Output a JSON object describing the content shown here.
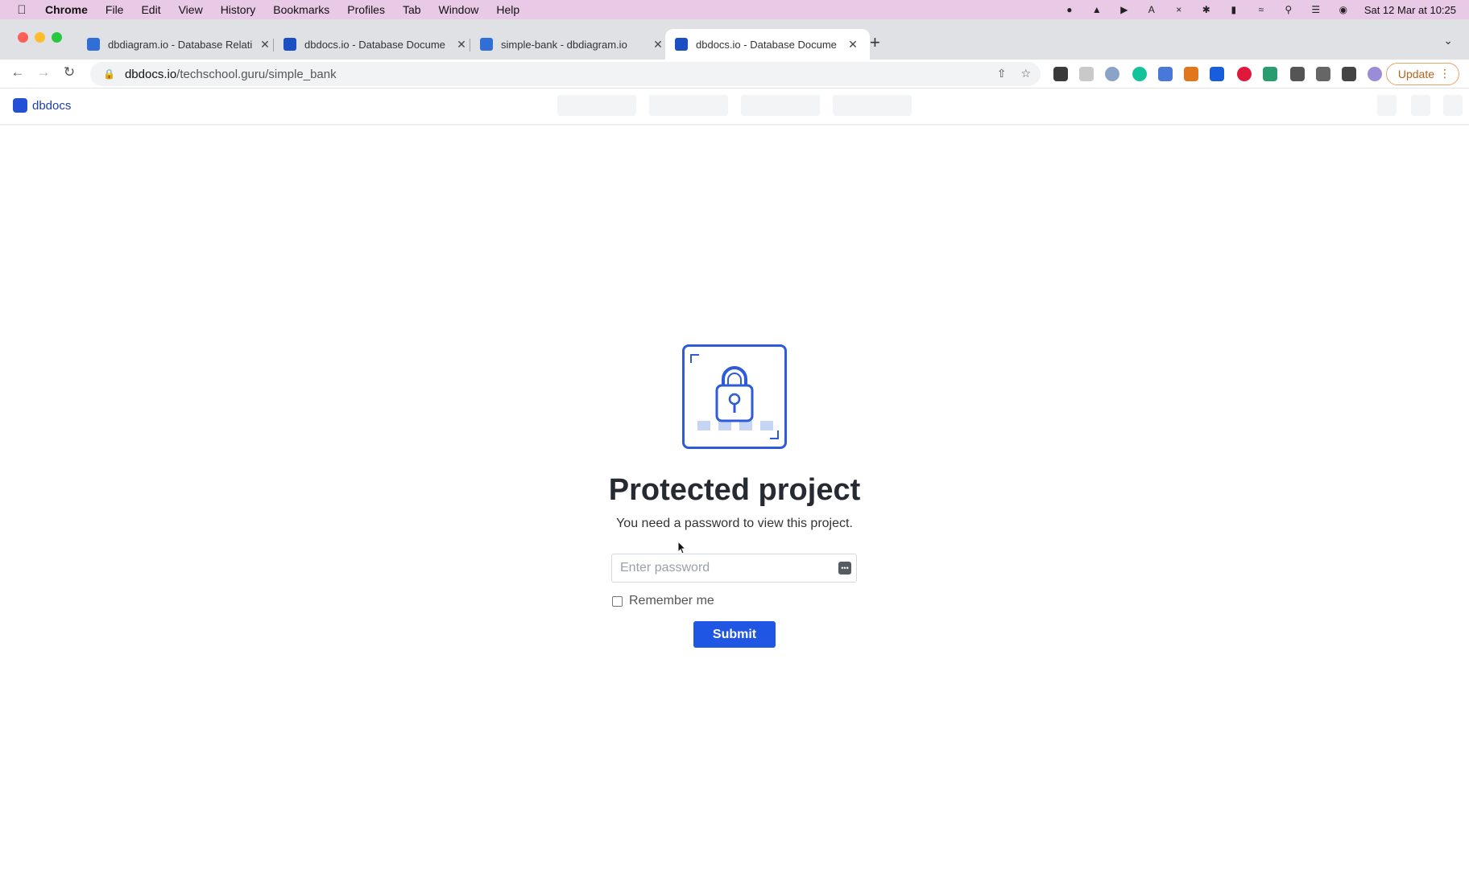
{
  "menubar": {
    "app": "Chrome",
    "items": [
      "File",
      "Edit",
      "View",
      "History",
      "Bookmarks",
      "Profiles",
      "Tab",
      "Window",
      "Help"
    ],
    "clock": "Sat 12 Mar at 10:25"
  },
  "tabs": [
    {
      "title": "dbdiagram.io - Database Relati",
      "favicon": "dbdiagram-icon"
    },
    {
      "title": "dbdocs.io - Database Docume",
      "favicon": "dbdocs-icon"
    },
    {
      "title": "simple-bank - dbdiagram.io",
      "favicon": "dbdiagram-icon"
    },
    {
      "title": "dbdocs.io - Database Docume",
      "favicon": "dbdocs-icon",
      "active": true
    }
  ],
  "toolbar": {
    "url_host": "dbdocs.io",
    "url_path": "/techschool.guru/simple_bank",
    "update_label": "Update"
  },
  "app": {
    "logo_text": "dbdocs"
  },
  "protected": {
    "title": "Protected project",
    "subtitle": "You need a password to view this project.",
    "password_placeholder": "Enter password",
    "remember_label": "Remember me",
    "remember_checked": false,
    "submit_label": "Submit"
  },
  "colors": {
    "accent": "#1f56e4",
    "menubar": "#e8c9e6",
    "lock_stroke": "#2d5bd9"
  }
}
